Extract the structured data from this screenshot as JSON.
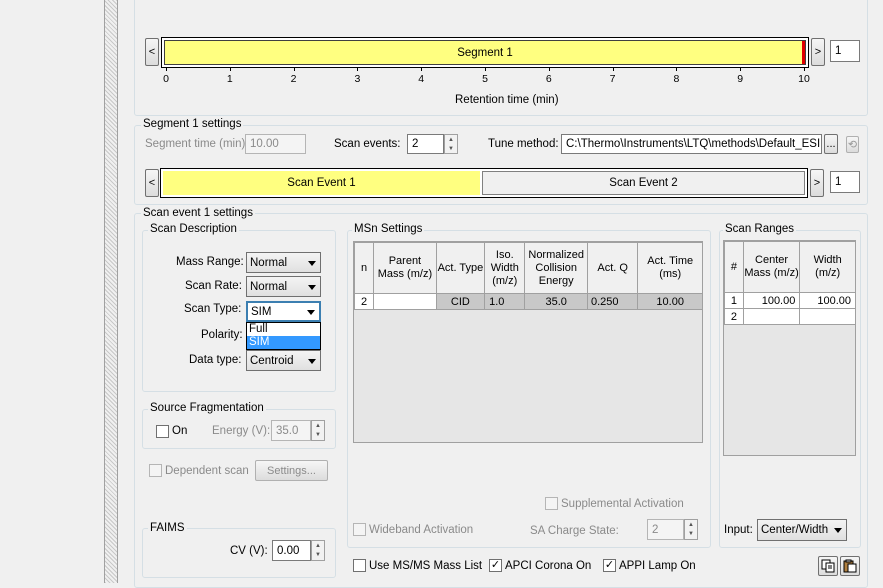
{
  "timeline": {
    "segment_label": "Segment 1",
    "ticks": [
      "0",
      "1",
      "2",
      "3",
      "4",
      "5",
      "6",
      "7",
      "8",
      "9",
      "10"
    ],
    "axis_label": "Retention time (min)",
    "count": "1",
    "prev_label": "<",
    "next_label": ">"
  },
  "segment_settings": {
    "title": "Segment 1 settings",
    "segment_time_label": "Segment time (min):",
    "segment_time_value": "10.00",
    "scan_events_label": "Scan events:",
    "scan_events_value": "2",
    "tune_method_label": "Tune method:",
    "tune_method_value": "C:\\Thermo\\Instruments\\LTQ\\methods\\Default_ESI.LT",
    "browse_label": "...",
    "scan_event_tabs": [
      "Scan Event 1",
      "Scan Event 2"
    ],
    "event_count": "1"
  },
  "scan_event_settings": {
    "title": "Scan event 1 settings",
    "scan_description": {
      "title": "Scan Description",
      "mass_range_label": "Mass Range:",
      "mass_range_value": "Normal",
      "scan_rate_label": "Scan Rate:",
      "scan_rate_value": "Normal",
      "scan_type_label": "Scan Type:",
      "scan_type_value": "SIM",
      "scan_type_options": [
        "Full",
        "SIM"
      ],
      "polarity_label": "Polarity:",
      "data_type_label": "Data type:",
      "data_type_value": "Centroid"
    },
    "source_fragmentation": {
      "title": "Source Fragmentation",
      "on_label": "On",
      "energy_label": "Energy (V):",
      "energy_value": "35.0"
    },
    "dependent_scan_label": "Dependent scan",
    "settings_button": "Settings...",
    "faims": {
      "title": "FAIMS",
      "cv_label": "CV (V):",
      "cv_value": "0.00"
    },
    "msn_settings": {
      "title": "MSn Settings",
      "headers": [
        "n",
        "Parent Mass (m/z)",
        "Act. Type",
        "Iso. Width (m/z)",
        "Normalized Collision Energy",
        "Act. Q",
        "Act. Time (ms)"
      ],
      "rows": [
        [
          "2",
          "",
          "CID",
          "1.0",
          "35.0",
          "0.250",
          "10.00"
        ]
      ],
      "supplemental_activation_label": "Supplemental Activation",
      "wideband_activation_label": "Wideband Activation",
      "sa_charge_state_label": "SA Charge State:",
      "sa_charge_state_value": "2"
    },
    "scan_ranges": {
      "title": "Scan Ranges",
      "headers": [
        "#",
        "Center Mass (m/z)",
        "Width (m/z)"
      ],
      "rows": [
        [
          "1",
          "100.00",
          "100.00"
        ],
        [
          "2",
          "",
          ""
        ]
      ],
      "input_label": "Input:",
      "input_value": "Center/Width"
    },
    "bottom": {
      "use_msms_label": "Use MS/MS Mass List",
      "apci_label": "APCI Corona On",
      "appi_label": "APPI Lamp On"
    }
  },
  "colors": {
    "segment_yellow": "#ffff80",
    "selection_blue": "#3399ff",
    "marker_red": "#e00000"
  }
}
